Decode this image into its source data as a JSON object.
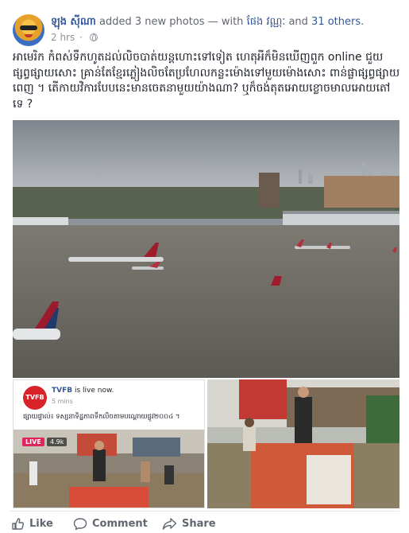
{
  "post": {
    "author": "ឡុង ស៊ីណា",
    "action_text": "added 3 new photos — with",
    "tagged_user": "ផែង វណ្ណៈ",
    "and_text": "and",
    "others": "31 others",
    "period": ".",
    "time": "2 hrs",
    "privacy_icon": "globe-icon",
    "text": "អាមេរិក កំពស់ទឹកហូតដល់លិចបាត់យន្តហោះទៅទៀត ហេតុអីក៏មិនឃើញពួក online ជួយផ្សព្វផ្សាយសោះ គ្រាន់តែខ្មែរភ្លៀងលិចតែប្រហែលកន្លះម៉ោងទៅមួយម៉ោងសោះ ពាន់ផ្លាផ្សព្វផ្សាយពេញ ។ តើកាយវិការបែបនេះមានចេតនាមួយយ៉ាងណា? ឬក៏ចង់តុតអោយខ្លោចមាលអោយតៅទេ ?"
  },
  "embedded_live": {
    "page_name": "TVFB",
    "logo_text": "TVFB",
    "status": "is live now.",
    "time": "5 mins",
    "caption": "ផ្សាយផ្ទាល់៖ ទស្សនាទិដ្ឋភាពទឹកលិចតាមបណ្តោយផ្លូវ២០០៤ ។",
    "live_badge": "LIVE",
    "viewers": "4.9k"
  },
  "actions": {
    "like": "Like",
    "comment": "Comment",
    "share": "Share"
  },
  "colors": {
    "link": "#365899",
    "muted": "#616770",
    "live": "#e0245e",
    "tvfb": "#d8232a"
  }
}
